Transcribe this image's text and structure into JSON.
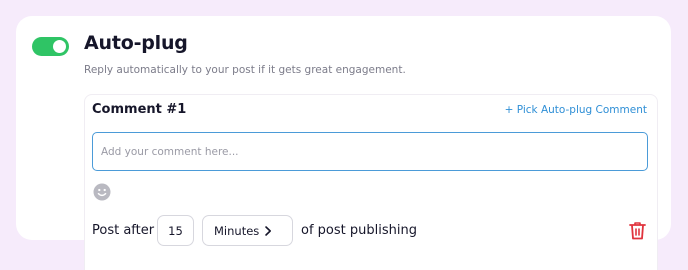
{
  "autoplug": {
    "enabled": true,
    "title": "Auto-plug",
    "description": "Reply automatically to your post if it gets great engagement."
  },
  "comment": {
    "label": "Comment #1",
    "pick_link": "+ Pick Auto-plug Comment",
    "value": "",
    "placeholder": "Add your comment here..."
  },
  "schedule": {
    "prefix": "Post after",
    "amount": "15",
    "unit": "Minutes",
    "suffix": "of post publishing"
  },
  "icons": {
    "emoji": "emoji-smile-icon",
    "chevron": "chevron-right-icon",
    "delete": "trash-icon"
  },
  "colors": {
    "page_background": "#f6ebfb",
    "toggle_on": "#2fc465",
    "link": "#2f8fd6",
    "input_focus_border": "#4b9bd8",
    "delete": "#e0333d"
  }
}
